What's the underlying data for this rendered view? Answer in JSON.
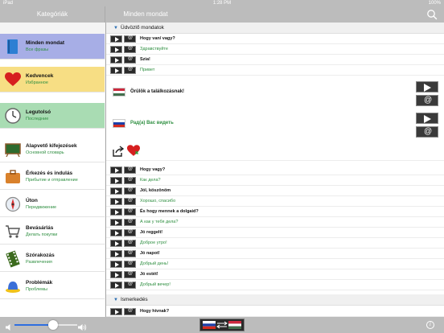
{
  "status_bar": {
    "carrier": "iPad",
    "time": "1:28 PM",
    "battery": "100%"
  },
  "nav": {
    "left_title": "Kategóriák",
    "center_title": "Minden mondat"
  },
  "categories": [
    {
      "title": "Minden mondat",
      "subtitle": "Все фразы",
      "icon": "book-icon",
      "highlight": "#a7aee6"
    },
    {
      "title": "Kedvencek",
      "subtitle": "Избранное",
      "icon": "heart-icon",
      "highlight": "#f7de84"
    },
    {
      "title": "Legutolsó",
      "subtitle": "Последние",
      "icon": "clock-icon",
      "highlight": "#a9dcb3"
    },
    {
      "title": "Alapvető kifejezések",
      "subtitle": "Основной словарь",
      "icon": "chalkboard-icon"
    },
    {
      "title": "Érkezés és indulás",
      "subtitle": "Прибытие и отправление",
      "icon": "suitcase-icon"
    },
    {
      "title": "Úton",
      "subtitle": "Передвижение",
      "icon": "compass-icon"
    },
    {
      "title": "Bevásárlás",
      "subtitle": "Делать покупки",
      "icon": "cart-icon"
    },
    {
      "title": "Szórakozás",
      "subtitle": "Развлечения",
      "icon": "film-icon"
    },
    {
      "title": "Problémák",
      "subtitle": "Проблемы",
      "icon": "siren-icon"
    }
  ],
  "sections": [
    {
      "title": "Üdvözlő mondatok"
    },
    {
      "title": "Ismerkedés"
    }
  ],
  "rows_top": [
    {
      "lang": "hu",
      "text": "Hogy van/ vagy?"
    },
    {
      "lang": "ru",
      "text": "Здравствуйте"
    },
    {
      "lang": "hu",
      "text": "Szia!"
    },
    {
      "lang": "ru",
      "text": "Привет"
    }
  ],
  "expanded": {
    "hu_text": "Örülök a találkozásnak!",
    "ru_text": "Рад(а) Вас видеть"
  },
  "rows_bottom": [
    {
      "lang": "hu",
      "text": "Hogy vagy?"
    },
    {
      "lang": "ru",
      "text": "Как дела?"
    },
    {
      "lang": "hu",
      "text": "Jól, köszönöm"
    },
    {
      "lang": "ru",
      "text": "Хорошо, спасибо"
    },
    {
      "lang": "hu",
      "text": "És hogy mennek a dolgaid?"
    },
    {
      "lang": "ru",
      "text": "А как у тебя дела?"
    },
    {
      "lang": "hu",
      "text": "Jó reggelt!"
    },
    {
      "lang": "ru",
      "text": "Доброе утро!"
    },
    {
      "lang": "hu",
      "text": "Jó napot!"
    },
    {
      "lang": "ru",
      "text": "Добрый день!"
    },
    {
      "lang": "hu",
      "text": "Jó estét!"
    },
    {
      "lang": "ru",
      "text": "Добрый вечер!"
    }
  ],
  "rows_last": [
    {
      "lang": "hu",
      "text": "Hogy hívnak?"
    }
  ],
  "bottom_bar": {
    "volume": 0.62
  }
}
